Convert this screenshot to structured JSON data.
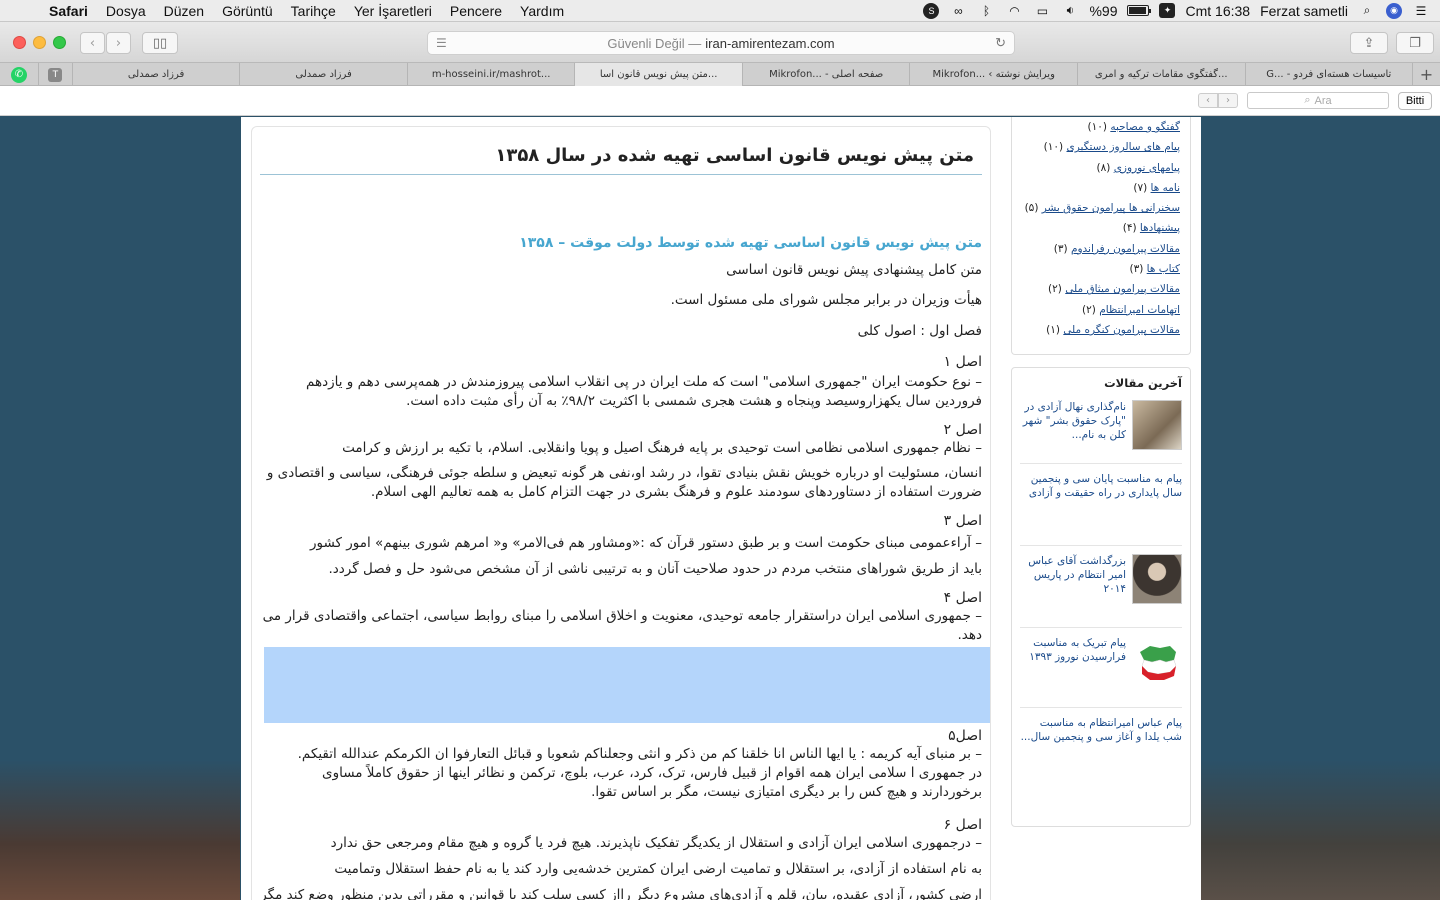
{
  "menubar": {
    "app": "Safari",
    "menus": [
      "Dosya",
      "Düzen",
      "Görüntü",
      "Tarihçe",
      "Yer İşaretleri",
      "Pencere",
      "Yardım"
    ],
    "battery": "%99",
    "clock": "Cmt 16:38",
    "user": "Ferzat sametli"
  },
  "toolbar": {
    "security": "Güvenli Değil —",
    "domain": "iran-amirentezam.com"
  },
  "tabs": [
    {
      "label": "فرزاد صمدلی"
    },
    {
      "label": "فرزاد صمدلی"
    },
    {
      "label": "m-hosseini.ir/mashrot..."
    },
    {
      "label": "متن پیش نویس قانون اسا..."
    },
    {
      "label": "Mikrofon... - صفحه اصلی"
    },
    {
      "label": "Mikrofon... ‹ ویرایش نوشته"
    },
    {
      "label": "گفتگوی مقامات ترکیه و امری..."
    },
    {
      "label": "G... - تاسیسات هسته‌ای فردو"
    }
  ],
  "findbar": {
    "placeholder": "Ara",
    "done": "Bitti"
  },
  "article": {
    "title": "متن پیش نویس قانون اساسی تهیه شده در سال ۱۳۵۸",
    "subtitle": "متن پیش نویس قانون اساسی تهیه شده توسط دولت موقت – ۱۳۵۸",
    "intro1": "متن کامل پیشنهادی پیش نویس قانون اساسی",
    "intro2": "هیأت وزیران در برابر مجلس شورای ملی مسئول است.",
    "chapter": "فصل اول : اصول کلی",
    "asl1_title": "اصل ۱",
    "asl1_text": "– نوع حکومت ایران \"جمهوری اسلامی\" است که ملت ایران در پی انقلاب اسلامی پیروزمندش در همه‌پرسی دهم و یازدهم فروردین سال یکهزاروسیصد وپنجاه و هشت هجری شمسی با اکثریت ۹۸/۲٪ به آن رأی مثبت داده است.",
    "asl2_title": "اصل ۲",
    "asl2_text1": "– نظام جمهوری اسلامی نظامی است توحیدی بر پایه فرهنگ اصیل و پویا وانقلابی. اسلام، با تکیه بر ارزش و کرامت",
    "asl2_text2": "انسان، مسئولیت او درباره خویش نقش بنیادی تقوا، در رشد او،نفی هر گونه تبعیض و سلطه جوئی فرهنگی، سیاسی و اقتصادی و ضرورت استفاده از دستاوردهای سودمند علوم و فرهنگ بشری در جهت التزام کامل به همه تعالیم الهی اسلام.",
    "asl3_title": "اصل ۳",
    "asl3_text1": "– آراءعمومی مبنای حکومت است و بر طبق دستور قرآن که :«ومشاور هم فی‌الامر» و« امرهم شوری بینهم» امور کشور",
    "asl3_text2": "باید از طریق شوراهای منتخب مردم در حدود صلاحیت آنان و به ترتیبی ناشی از آن مشخص می‌شود حل و فصل گردد.",
    "asl4_title": "اصل ۴",
    "asl4_text": "– جمهوری اسلامی ایران دراستقرار جامعه توحیدی، معنویت و اخلاق اسلامی را مبنای روابط سیاسی، اجتماعی واقتصادی قرار می دهد.",
    "asl5_title": "اصل۵",
    "asl5_text1": "– بر منبای آیه کریمه : یا ایها الناس انا خلقنا کم من ذکر و انثی وجعلناکم شعوبا و قبائل التعارفوا ان الکرمکم عندالله اتقیکم.",
    "asl5_text2": "در جمهوری ا سلامی ایران همه اقوام از قبیل فارس، ترک، کرد، عرب، بلوچ، ترکمن و نظائر اینها از حقوق کاملاً مساوی برخوردارند و هیچ کس را بر دیگری امتیازی نیست، مگر بر اساس تقوا.",
    "asl6_title": "اصل ۶",
    "asl6_text1": "– درجمهوری اسلامی ایران آزادی و استقلال از یکدیگر تفکیک ناپذیرند. هیچ فرد یا گروه و هیچ مقام ومرجعی حق ندارد",
    "asl6_text2": "به نام استفاده از آزادی، بر استقلال و تمامیت ارضی ایران کمترین خدشه‌یی وارد کند یا به نام حفظ استقلال وتمامیت",
    "asl6_text3": "ارضی کشور، آزادی عقیده، بیان، قلم و آزادی‌های مشروع دیگر رااز کسی سلب کند یا قوانین و مقرراتی بدین منظور وضع کند مگر در حالت جنگ."
  },
  "sidebar": {
    "categories": [
      {
        "name": "گفتگو و مصاحبه",
        "count": "(۱۰)"
      },
      {
        "name": "پیام های سالروز دستگیری",
        "count": "(۱۰)"
      },
      {
        "name": "پیامهای نوروزی",
        "count": "(۸)"
      },
      {
        "name": "نامه ها",
        "count": "(۷)"
      },
      {
        "name": "سخنرانی ها پیرامون حقوق بشر",
        "count": "(۵)"
      },
      {
        "name": "پیشنهادها",
        "count": "(۴)"
      },
      {
        "name": "مقالات پیرامون رفراندوم",
        "count": "(۳)"
      },
      {
        "name": "کتاب ها",
        "count": "(۳)"
      },
      {
        "name": "مقالات پیرامون میثاق ملی",
        "count": "(۲)"
      },
      {
        "name": "اتهامات امیرانتظام",
        "count": "(۲)"
      },
      {
        "name": "مقالات پیرامون کنگره ملی",
        "count": "(۱)"
      }
    ],
    "latest_title": "آخرین مقالات",
    "posts": [
      {
        "title": "نام‌گذاری نهال آزادی در \"پارک حقوق بشر\" شهر کلن به نام..."
      },
      {
        "title": "پیام به مناسبت پایان سی و پنجمین سال پایداری در راه حقیقت و آزادی"
      },
      {
        "title": "بزرگداشت آقای عباس امیر انتظام در پاریس ۲۰۱۴"
      },
      {
        "title": "پیام تبریک به مناسبت فرارسیدن نوروز ۱۳۹۳"
      },
      {
        "title": "پیام عباس امیرانتظام به مناسبت شب یلدا و آغاز سی و پنجمین سال..."
      }
    ]
  }
}
